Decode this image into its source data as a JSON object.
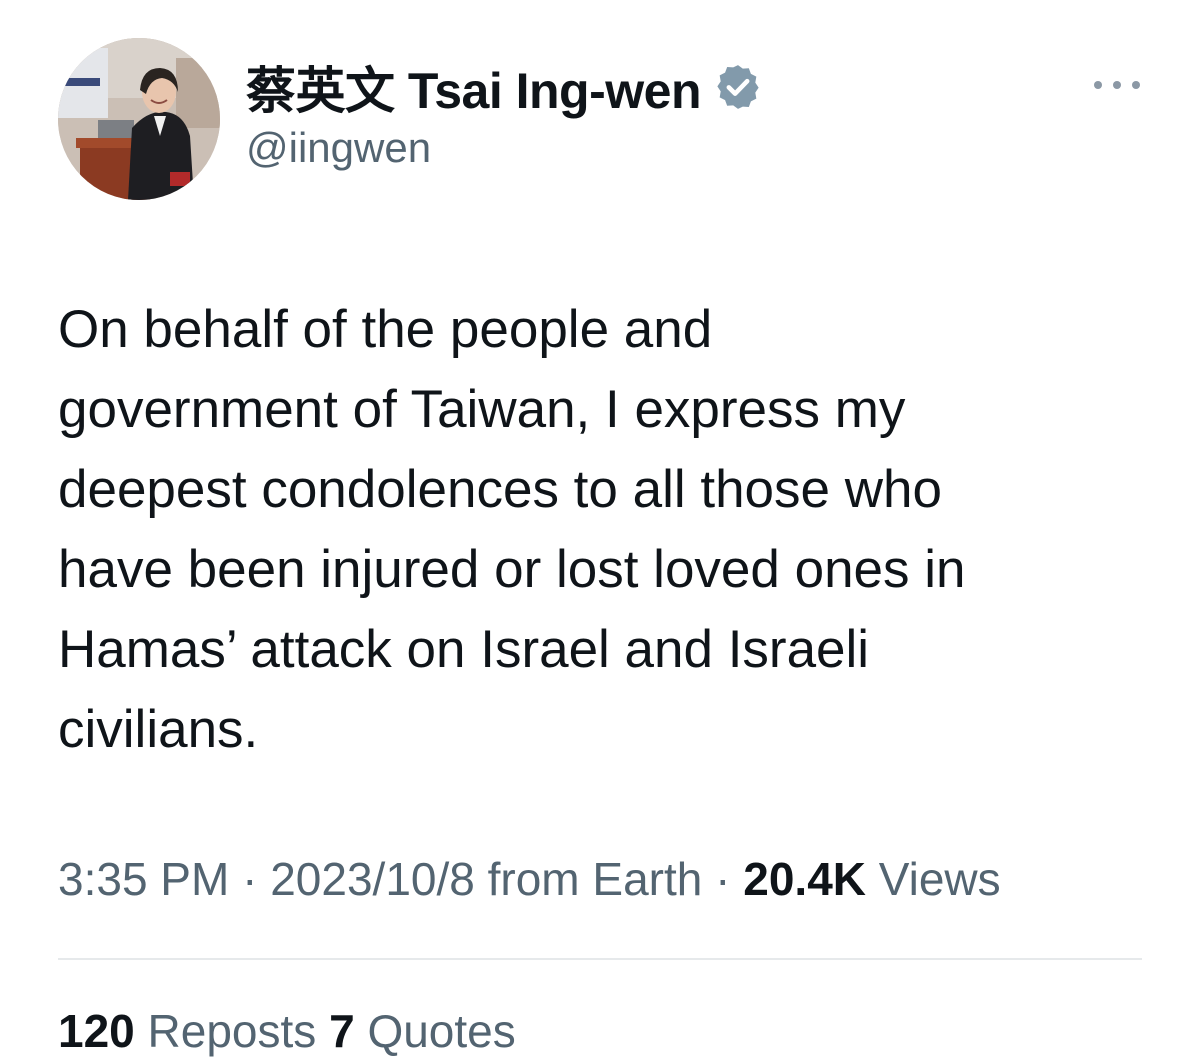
{
  "author": {
    "display_name": "蔡英文 Tsai Ing-wen",
    "handle": "@iingwen",
    "verified_icon": "verified-badge-icon",
    "verified_color": "#829aab"
  },
  "menu": {
    "more_icon": "more-horizontal-icon"
  },
  "tweet": {
    "text_lines": [
      "On behalf of the people and",
      "government of Taiwan, I express my",
      "deepest condolences to all those who",
      "have been injured or lost loved ones in",
      "Hamas’ attack on Israel and Israeli",
      "civilians."
    ]
  },
  "meta": {
    "time": "3:35 PM",
    "separator": "·",
    "date_source": "2023/10/8 from Earth",
    "views_count": "20.4K",
    "views_label": "Views"
  },
  "stats": {
    "reposts_count": "120",
    "reposts_label": "Reposts",
    "quotes_count": "7",
    "quotes_label": "Quotes"
  },
  "colors": {
    "text_primary": "#0f1419",
    "text_secondary": "#536471",
    "divider": "#e6e9eb"
  }
}
